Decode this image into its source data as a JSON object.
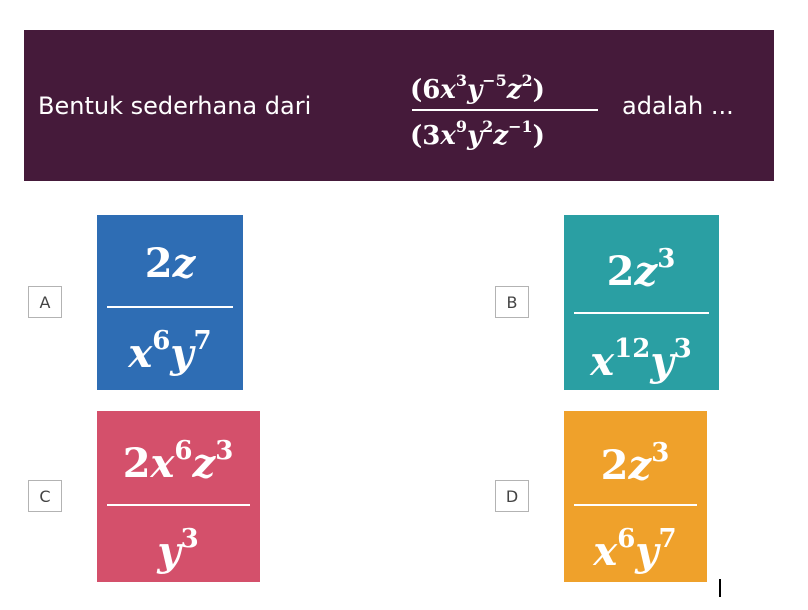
{
  "question": {
    "prefix": "Bentuk sederhana dari",
    "suffix": "adalah ...",
    "numerator": {
      "open": "(6",
      "x": "x",
      "x_exp": "3",
      "y": "y",
      "y_exp": "−5",
      "z": "z",
      "z_exp": "2",
      "close": ")"
    },
    "denominator": {
      "open": "(3",
      "x": "x",
      "x_exp": "9",
      "y": "y",
      "y_exp": "2",
      "z": "z",
      "z_exp": "−1",
      "close": ")"
    }
  },
  "options": [
    {
      "letter": "A",
      "color": "#2e6db4",
      "numerator": {
        "coef": "2",
        "v1": "z",
        "v1_exp": ""
      },
      "denominator": {
        "v1": "x",
        "v1_exp": "6",
        "v2": "y",
        "v2_exp": "7"
      }
    },
    {
      "letter": "B",
      "color": "#2a9fa3",
      "numerator": {
        "coef": "2",
        "v1": "z",
        "v1_exp": "3"
      },
      "denominator": {
        "v1": "x",
        "v1_exp": "12",
        "v2": "y",
        "v2_exp": "3"
      }
    },
    {
      "letter": "C",
      "color": "#d4506b",
      "numerator": {
        "coef": "2",
        "v1": "x",
        "v1_exp": "6",
        "v2": "z",
        "v2_exp": "3"
      },
      "denominator": {
        "v1": "y",
        "v1_exp": "3"
      }
    },
    {
      "letter": "D",
      "color": "#efa12b",
      "numerator": {
        "coef": "2",
        "v1": "z",
        "v1_exp": "3"
      },
      "denominator": {
        "v1": "x",
        "v1_exp": "6",
        "v2": "y",
        "v2_exp": "7"
      }
    }
  ],
  "colors": {
    "banner": "#451a3a",
    "text_on_color": "#ffffff",
    "letter_border": "#b3b3b3"
  }
}
